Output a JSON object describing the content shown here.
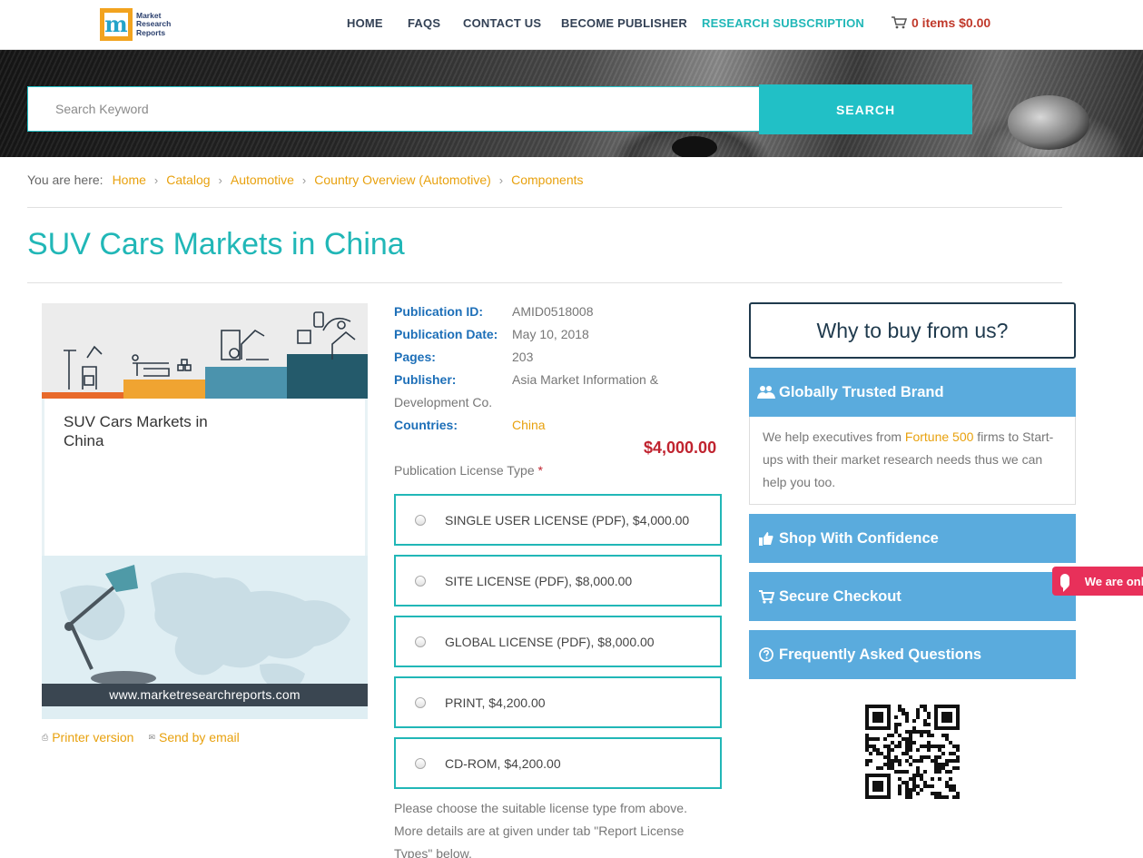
{
  "header": {
    "logo_lines": [
      "Market",
      "Research",
      "Reports"
    ],
    "logo_letter": "m",
    "nav": {
      "home": "HOME",
      "faqs": "FAQS",
      "contact": "CONTACT US",
      "publisher": "BECOME PUBLISHER",
      "subscription": "RESEARCH SUBSCRIPTION"
    },
    "cart": "0 items $0.00"
  },
  "search": {
    "placeholder": "Search Keyword",
    "button": "SEARCH"
  },
  "breadcrumb": {
    "label": "You are here:",
    "items": [
      "Home",
      "Catalog",
      "Automotive",
      "Country Overview (Automotive)",
      "Components"
    ],
    "separator": "›"
  },
  "page_title": "SUV Cars Markets in China",
  "cover": {
    "title": "SUV Cars Markets in China",
    "url": "www.marketresearchreports.com"
  },
  "tools": {
    "printer": "Printer version",
    "email": "Send by email"
  },
  "details": {
    "publication_id_label": "Publication ID:",
    "publication_id": "AMID0518008",
    "publication_date_label": "Publication Date:",
    "publication_date": "May 10, 2018",
    "pages_label": "Pages:",
    "pages": "203",
    "publisher_label": "Publisher:",
    "publisher_line1": "Asia Market Information &",
    "publisher_line2": "Development Co.",
    "countries_label": "Countries:",
    "countries": "China"
  },
  "price": "$4,000.00",
  "license": {
    "label": "Publication License Type",
    "required_mark": "*",
    "options": [
      "SINGLE USER LICENSE (PDF), $4,000.00",
      "SITE LICENSE (PDF), $8,000.00",
      "GLOBAL LICENSE (PDF), $8,000.00",
      "PRINT, $4,200.00",
      "CD-ROM, $4,200.00"
    ],
    "note": "Please choose the suitable license type from above. More details are at given under tab \"Report License Types\" below."
  },
  "why": {
    "heading": "Why to buy from us?",
    "trusted": "Globally Trusted Brand",
    "trusted_body_pre": "We help executives from ",
    "trusted_body_hl": "Fortune 500",
    "trusted_body_post": " firms to Start-ups with their market research needs thus we can help you too.",
    "confidence": "Shop With Confidence",
    "checkout": "Secure Checkout",
    "faq": "Frequently Asked Questions"
  },
  "chat": "We are online",
  "colors": {
    "teal": "#21b7b7",
    "orange_link": "#e8a10e",
    "price_red": "#c0232f",
    "panel_blue": "#5aabdd",
    "label_blue": "#1d6fb8"
  }
}
